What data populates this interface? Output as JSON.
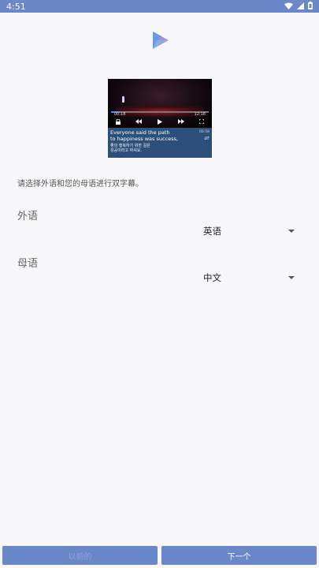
{
  "status_bar": {
    "time": "4:51",
    "icons": [
      "wifi-icon",
      "signal-icon",
      "battery-icon"
    ]
  },
  "logo": {
    "icon": "play-logo-icon",
    "colors": [
      "#6a9be0",
      "#a17ad6"
    ]
  },
  "video_preview": {
    "time_current": "00:18",
    "time_total": "12:18",
    "progress": 0.1,
    "controls": [
      "lock-icon",
      "rewind-icon",
      "play-icon",
      "fast-forward-icon",
      "fullscreen-icon"
    ],
    "subtitle_primary_line1": "Everyone said the path",
    "subtitle_primary_line2": "to happiness was success,",
    "subtitle_secondary_line1": "좋의 행복하기 위한 길은",
    "subtitle_secondary_line2": "성공이라고 하셔요.",
    "subtitle_meta": "00:58"
  },
  "instruction": "请选择外语和您的母语进行双字幕。",
  "foreign_language": {
    "label": "外语",
    "selected": "英语"
  },
  "native_language": {
    "label": "母语",
    "selected": "中文"
  },
  "buttons": {
    "previous": "以前的",
    "next": "下一个"
  },
  "colors": {
    "accent": "#6a87c9",
    "background": "#f7f7f9",
    "subtitle_panel": "#2c4f7a"
  }
}
